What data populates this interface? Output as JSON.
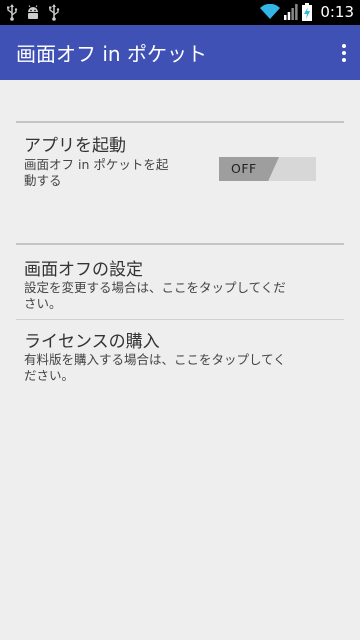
{
  "status_bar": {
    "icons_left": [
      "usb-icon",
      "android-icon",
      "usb-icon"
    ],
    "icons_right": [
      "wifi-icon",
      "signal-icon",
      "battery-charging-icon"
    ],
    "time": "0:13"
  },
  "app_bar": {
    "title": "画面オフ in ポケット",
    "overflow_icon": "more-vert-icon"
  },
  "prefs": {
    "enable": {
      "title": "アプリを起動",
      "summary_line1": "画面オフ in ポケットを起",
      "summary_line2": "動する",
      "toggle_label": "OFF",
      "toggle_state": "off"
    },
    "settings": {
      "title": "画面オフの設定",
      "summary_line1": "設定を変更する場合は、ここをタップしてくだ",
      "summary_line2": "さい。"
    },
    "license": {
      "title": "ライセンスの購入",
      "summary_line1": "有料版を購入する場合は、ここをタップしてく",
      "summary_line2": "ださい。"
    }
  },
  "colors": {
    "primary": "#3f51b5",
    "background": "#eeeeee",
    "status_bar": "#000000"
  }
}
